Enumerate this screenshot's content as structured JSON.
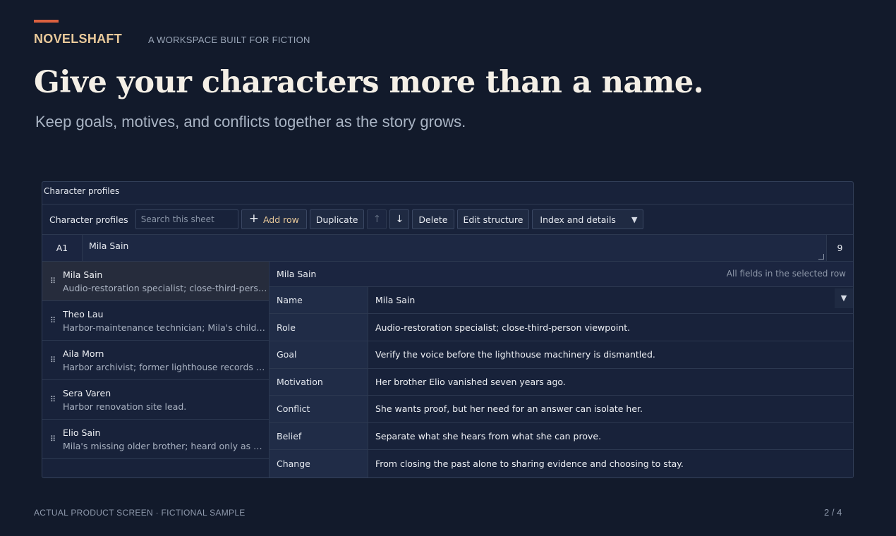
{
  "hero": {
    "brand": "NOVELSHAFT",
    "tagline": "A WORKSPACE BUILT FOR FICTION",
    "headline": "Give your characters more than a name.",
    "subhead": "Keep goals, motives, and conflicts together as the story grows."
  },
  "colors": {
    "accent": "#d9603f",
    "brand": "#e9c99a",
    "background": "#121a2b"
  },
  "app": {
    "title": "Character profiles",
    "toolbar": {
      "sheet_label": "Character profiles",
      "search_placeholder": "Search this sheet",
      "add_row": "Add row",
      "duplicate": "Duplicate",
      "move_up": "↑",
      "move_down": "↓",
      "delete": "Delete",
      "edit_structure": "Edit structure",
      "view_select": "Index and details"
    },
    "formula_bar": {
      "cell_ref": "A1",
      "value": "Mila Sain",
      "count": "9"
    },
    "rows": [
      {
        "name": "Mila Sain",
        "desc": "Audio-restoration specialist; close-third-person viewpoint."
      },
      {
        "name": "Theo Lau",
        "desc": "Harbor-maintenance technician; Mila's childhood friend."
      },
      {
        "name": "Aila Morn",
        "desc": "Harbor archivist; former lighthouse records officer."
      },
      {
        "name": "Sera Varen",
        "desc": "Harbor renovation site lead."
      },
      {
        "name": "Elio Sain",
        "desc": "Mila's missing older brother; heard only as a voice."
      }
    ],
    "detail": {
      "title": "Mila Sain",
      "hint": "All fields in the selected row",
      "fields": [
        {
          "label": "Name",
          "value": "Mila Sain"
        },
        {
          "label": "Role",
          "value": "Audio-restoration specialist; close-third-person viewpoint."
        },
        {
          "label": "Goal",
          "value": "Verify the voice before the lighthouse machinery is dismantled."
        },
        {
          "label": "Motivation",
          "value": "Her brother Elio vanished seven years ago."
        },
        {
          "label": "Conflict",
          "value": "She wants proof, but her need for an answer can isolate her."
        },
        {
          "label": "Belief",
          "value": "Separate what she hears from what she can prove."
        },
        {
          "label": "Change",
          "value": "From closing the past alone to sharing evidence and choosing to stay."
        }
      ]
    }
  },
  "footer": {
    "left": "ACTUAL PRODUCT SCREEN · FICTIONAL SAMPLE",
    "right": "2 / 4"
  }
}
